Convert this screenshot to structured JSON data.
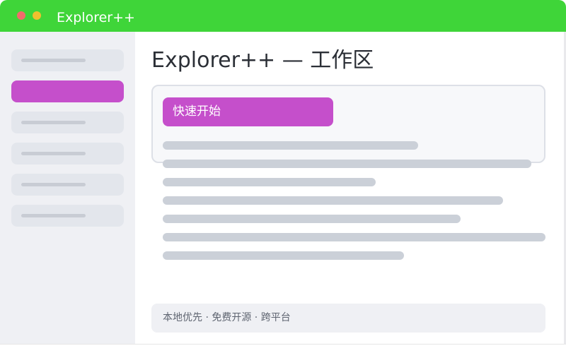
{
  "window": {
    "title": "Explorer++",
    "accent_color": "#3fd539"
  },
  "titlebar": {
    "controls": [
      {
        "name": "close",
        "color": "#f26b6b"
      },
      {
        "name": "minimize",
        "color": "#f0c02e"
      },
      {
        "name": "maximize",
        "color": "#3fd539"
      }
    ]
  },
  "sidebar": {
    "active_color": "#c54fcb",
    "item_count": 6,
    "active_index": 1
  },
  "main": {
    "title": "Explorer++ — 工作区",
    "primary_button": "快速开始",
    "footer_text": "本地优先 · 免费开源 · 跨平台"
  }
}
